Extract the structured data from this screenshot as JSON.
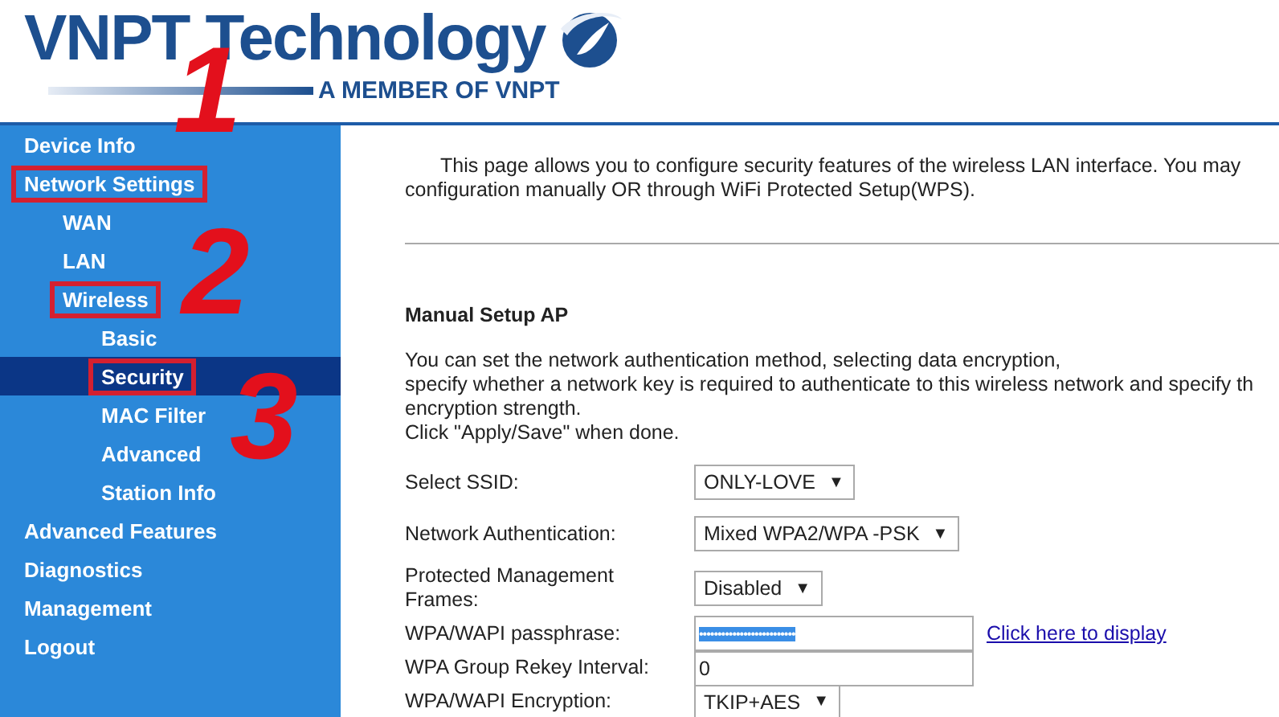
{
  "header": {
    "brand": "VNPT Technology",
    "tagline": "A MEMBER OF VNPT"
  },
  "sidebar": {
    "items": [
      {
        "label": "Device Info",
        "selected": false,
        "highlighted": false
      },
      {
        "label": "Network Settings",
        "selected": false,
        "highlighted": true,
        "children": [
          {
            "label": "WAN",
            "selected": false,
            "highlighted": false
          },
          {
            "label": "LAN",
            "selected": false,
            "highlighted": false
          },
          {
            "label": "Wireless",
            "selected": false,
            "highlighted": true,
            "children": [
              {
                "label": "Basic",
                "selected": false,
                "highlighted": false
              },
              {
                "label": "Security",
                "selected": true,
                "highlighted": true
              },
              {
                "label": "MAC Filter",
                "selected": false,
                "highlighted": false
              },
              {
                "label": "Advanced",
                "selected": false,
                "highlighted": false
              },
              {
                "label": "Station Info",
                "selected": false,
                "highlighted": false
              }
            ]
          }
        ]
      },
      {
        "label": "Advanced Features",
        "selected": false,
        "highlighted": false
      },
      {
        "label": "Diagnostics",
        "selected": false,
        "highlighted": false
      },
      {
        "label": "Management",
        "selected": false,
        "highlighted": false
      },
      {
        "label": "Logout",
        "selected": false,
        "highlighted": false
      }
    ]
  },
  "annotations": [
    {
      "text": "1"
    },
    {
      "text": "2"
    },
    {
      "text": "3"
    }
  ],
  "content": {
    "intro": [
      "This page allows you to configure security features of the wireless LAN interface. You may",
      "configuration manually OR through WiFi Protected Setup(WPS)."
    ],
    "section_title": "Manual Setup AP",
    "description": [
      "You can set the network authentication method, selecting data encryption,",
      "specify whether a network key is required to authenticate to this wireless network and specify th",
      "encryption strength.",
      "Click \"Apply/Save\" when done."
    ],
    "fields": [
      {
        "kind": "select",
        "label": "Select SSID:",
        "value": "ONLY-LOVE",
        "caret": "▼"
      },
      {
        "kind": "select",
        "label": "Network Authentication:",
        "value": "Mixed WPA2/WPA -PSK",
        "caret": "▼"
      },
      {
        "kind": "select",
        "label": "Protected Management Frames:",
        "value": "Disabled",
        "caret": "▼"
      },
      {
        "kind": "password",
        "label": "WPA/WAPI passphrase:",
        "value": "••••••••••••••••••••••••••",
        "text_selected": true,
        "link": "Click here to display"
      },
      {
        "kind": "text",
        "label": "WPA Group Rekey Interval:",
        "value": "0"
      },
      {
        "kind": "select",
        "label": "WPA/WAPI Encryption:",
        "value": "TKIP+AES",
        "caret": "▼"
      }
    ]
  }
}
